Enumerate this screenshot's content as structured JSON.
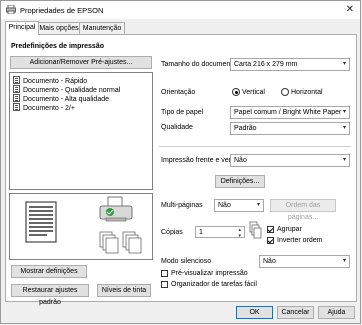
{
  "window": {
    "title": "Propriedades de EPSON",
    "close_glyph": "✕"
  },
  "tabs": [
    {
      "label": "Principal",
      "active": true
    },
    {
      "label": "Mais opções",
      "active": false
    },
    {
      "label": "Manutenção",
      "active": false
    }
  ],
  "presets": {
    "heading": "Predefinições de impressão",
    "add_remove_button": "Adicionar/Remover Pré-ajustes...",
    "items": [
      {
        "label": "Documento - Rápido",
        "icon": "document-icon"
      },
      {
        "label": "Documento - Qualidade normal",
        "icon": "document-icon"
      },
      {
        "label": "Documento - Alta qualidade",
        "icon": "document-icon"
      },
      {
        "label": "Documento - 2/+",
        "icon": "document-icon"
      }
    ]
  },
  "settings": {
    "paper_size_label": "Tamanho do documento",
    "paper_size_value": "Carta 216 x 279 mm",
    "orientation_label": "Orientação",
    "orientation_vertical": "Vertical",
    "orientation_horizontal": "Horizontal",
    "orientation_selected": "Vertical",
    "paper_type_label": "Tipo de papel",
    "paper_type_value": "Papel comum / Bright White Paper",
    "quality_label": "Qualidade",
    "quality_value": "Padrão",
    "duplex_label": "Impressão frente e verso",
    "duplex_value": "Não",
    "definitions_button": "Definições...",
    "multipage_label": "Multi-páginas",
    "multipage_value": "Não",
    "page_order_button": "Ordem das páginas...",
    "copies_label": "Cópias",
    "copies_value": "1",
    "collate_label": "Agrupar",
    "collate_checked": true,
    "reverse_label": "Inverter ordem",
    "reverse_checked": true,
    "quiet_mode_label": "Modo silencioso",
    "quiet_mode_value": "Não",
    "print_preview_label": "Pré-visualizar impressão",
    "print_preview_checked": false,
    "job_arranger_label": "Organizador de tarefas fácil",
    "job_arranger_checked": false
  },
  "bottom_buttons": {
    "show_settings": "Mostrar definições",
    "restore_defaults": "Restaurar ajustes padrão",
    "ink_levels": "Níveis de tinta"
  },
  "dialog_buttons": {
    "ok": "OK",
    "cancel": "Cancelar",
    "help": "Ajuda"
  },
  "colors": {
    "accent": "#0078d7",
    "printer_green": "#2e9e3e"
  }
}
